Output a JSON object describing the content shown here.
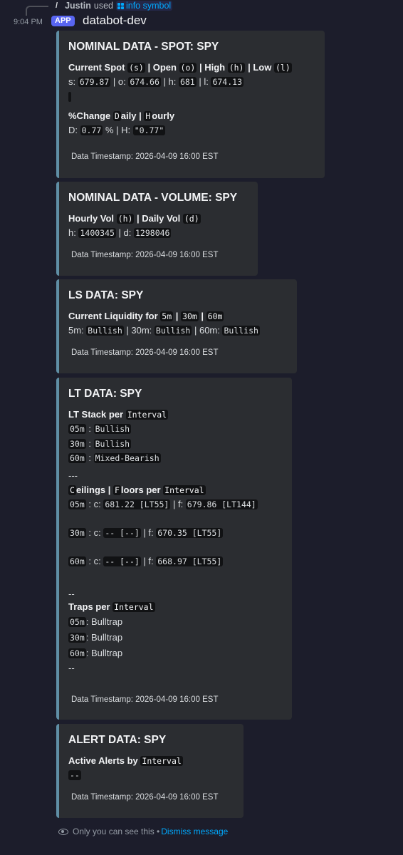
{
  "reply": {
    "user": "Justin",
    "verb": "used",
    "command": "info symbol"
  },
  "message": {
    "timestamp": "9:04 PM",
    "badge": "APP",
    "bot_name": "databot-dev"
  },
  "colors": {
    "embed_border": "#5f8ea5",
    "embed_bg": "#2b2d31",
    "badge": "#5865f2",
    "link": "#00a8fc"
  },
  "embeds": {
    "spot": {
      "title": "NOMINAL DATA - SPOT: SPY",
      "f1_name_a": "Current Spot ",
      "f1_code_s": "(s)",
      "f1_name_b": " | Open ",
      "f1_code_o": "(o)",
      "f1_name_c": " | High ",
      "f1_code_h": "(h)",
      "f1_name_d": " | Low ",
      "f1_code_l": "(l)",
      "s_label": "s: ",
      "s_val": "679.87",
      "o_label": " | o: ",
      "o_val": "674.66",
      "h_label": " | h: ",
      "h_val": "681",
      "l_label": " | l: ",
      "l_val": "674.13",
      "f2_name_a": "%Change ",
      "f2_code_d": "D",
      "f2_name_b": "aily | ",
      "f2_code_h": "H",
      "f2_name_c": "ourly",
      "d_label": "D: ",
      "d_val": "0.77",
      "d_pct": " % | H: ",
      "h2_val": "\"0.77\"",
      "footer": "Data Timestamp: 2026-04-09 16:00 EST"
    },
    "volume": {
      "title": "NOMINAL DATA - VOLUME: SPY",
      "name_a": "Hourly Vol ",
      "code_h": "(h)",
      "name_b": " | Daily Vol ",
      "code_d": "(d)",
      "h_label": "h: ",
      "h_val": "1400345",
      "d_label": " | d: ",
      "d_val": "1298046",
      "footer": "Data Timestamp: 2026-04-09 16:00 EST"
    },
    "ls": {
      "title": "LS DATA: SPY",
      "name_a": "Current Liquidity for ",
      "code_5": "5m",
      "sep1": " | ",
      "code_30": "30m",
      "sep2": " | ",
      "code_60": "60m",
      "v5_label": "5m: ",
      "v5": "Bullish",
      "v30_label": " | 30m: ",
      "v30": "Bullish",
      "v60_label": " | 60m: ",
      "v60": "Bullish",
      "footer": "Data Timestamp: 2026-04-09 16:00 EST"
    },
    "lt": {
      "title": "LT DATA: SPY",
      "stack_name": "LT Stack per ",
      "interval": "Interval",
      "stack": [
        {
          "tf": "05m",
          "val": "Bullish"
        },
        {
          "tf": "30m",
          "val": "Bullish"
        },
        {
          "tf": "60m",
          "val": "Mixed-Bearish"
        }
      ],
      "sep": "---",
      "cf_code_c": "C",
      "cf_name_a": "eilings | ",
      "cf_code_f": "F",
      "cf_name_b": "loors per ",
      "cf": [
        {
          "tf": "05m",
          "c": "681.22 [LT55]",
          "f": "679.86 [LT144]"
        },
        {
          "tf": "30m",
          "c": "-- [--]",
          "f": "670.35 [LT55]"
        },
        {
          "tf": "60m",
          "c": "-- [--]",
          "f": "668.97 [LT55]"
        }
      ],
      "c_label": " : c: ",
      "f_label": " | f: ",
      "dash": "--",
      "traps_name": "Traps per ",
      "traps": [
        {
          "tf": "05m",
          "val": "Bulltrap"
        },
        {
          "tf": "30m",
          "val": "Bulltrap"
        },
        {
          "tf": "60m",
          "val": "Bulltrap"
        }
      ],
      "footer": "Data Timestamp: 2026-04-09 16:00 EST"
    },
    "alert": {
      "title": "ALERT DATA: SPY",
      "name_a": "Active Alerts by ",
      "code_interval": "Interval",
      "value": "--",
      "footer": "Data Timestamp: 2026-04-09 16:00 EST"
    }
  },
  "ephemeral": {
    "text": "Only you can see this • ",
    "dismiss": "Dismiss message"
  }
}
